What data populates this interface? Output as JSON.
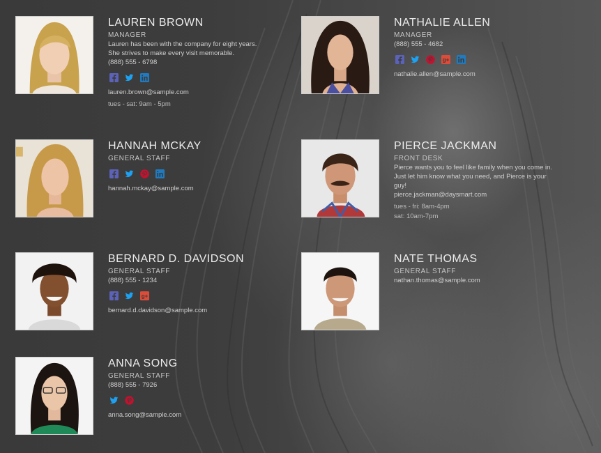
{
  "colors": {
    "facebook": "#5b62b8",
    "twitter": "#1da1f2",
    "pinterest": "#c8102e",
    "googleplus": "#dd4b39",
    "linkedin": "#1f7bc1"
  },
  "staff": [
    {
      "name": "LAUREN BROWN",
      "role": "MANAGER",
      "bio_1": "Lauren has been with the company for eight years.",
      "bio_2": "She strives to make every visit memorable.",
      "phone": "(888) 555 - 6798",
      "social": [
        "facebook-icon",
        "twitter-icon",
        "linkedin-icon"
      ],
      "email": "lauren.brown@sample.com",
      "hours_1": "tues - sat: 9am - 5pm"
    },
    {
      "name": "NATHALIE ALLEN",
      "role": "MANAGER",
      "phone": "(888) 555 - 4682",
      "social": [
        "facebook-icon",
        "twitter-icon",
        "pinterest-icon",
        "googleplus-icon",
        "linkedin-icon"
      ],
      "email": "nathalie.allen@sample.com"
    },
    {
      "name": "HANNAH MCKAY",
      "role": "GENERAL STAFF",
      "social": [
        "facebook-icon",
        "twitter-icon",
        "pinterest-icon",
        "linkedin-icon"
      ],
      "email": "hannah.mckay@sample.com"
    },
    {
      "name": "PIERCE JACKMAN",
      "role": "FRONT DESK",
      "bio_1": "Pierce wants you to feel like family when you come in.",
      "bio_2": "Just let him know what you need, and Pierce is your",
      "bio_3": "guy!",
      "email": "pierce.jackman@daysmart.com",
      "hours_1": "tues - fri: 8am-4pm",
      "hours_2": "sat: 10am-7pm"
    },
    {
      "name": "BERNARD D. DAVIDSON",
      "role": "GENERAL STAFF",
      "phone": "(888) 555 - 1234",
      "social": [
        "facebook-icon",
        "twitter-icon",
        "googleplus-icon"
      ],
      "email": "bernard.d.davidson@sample.com"
    },
    {
      "name": "NATE THOMAS",
      "role": "GENERAL STAFF",
      "email": "nathan.thomas@sample.com"
    },
    {
      "name": "ANNA SONG",
      "role": "GENERAL STAFF",
      "phone": "(888) 555 - 7926",
      "social": [
        "twitter-icon",
        "pinterest-icon"
      ],
      "email": "anna.song@sample.com"
    }
  ]
}
